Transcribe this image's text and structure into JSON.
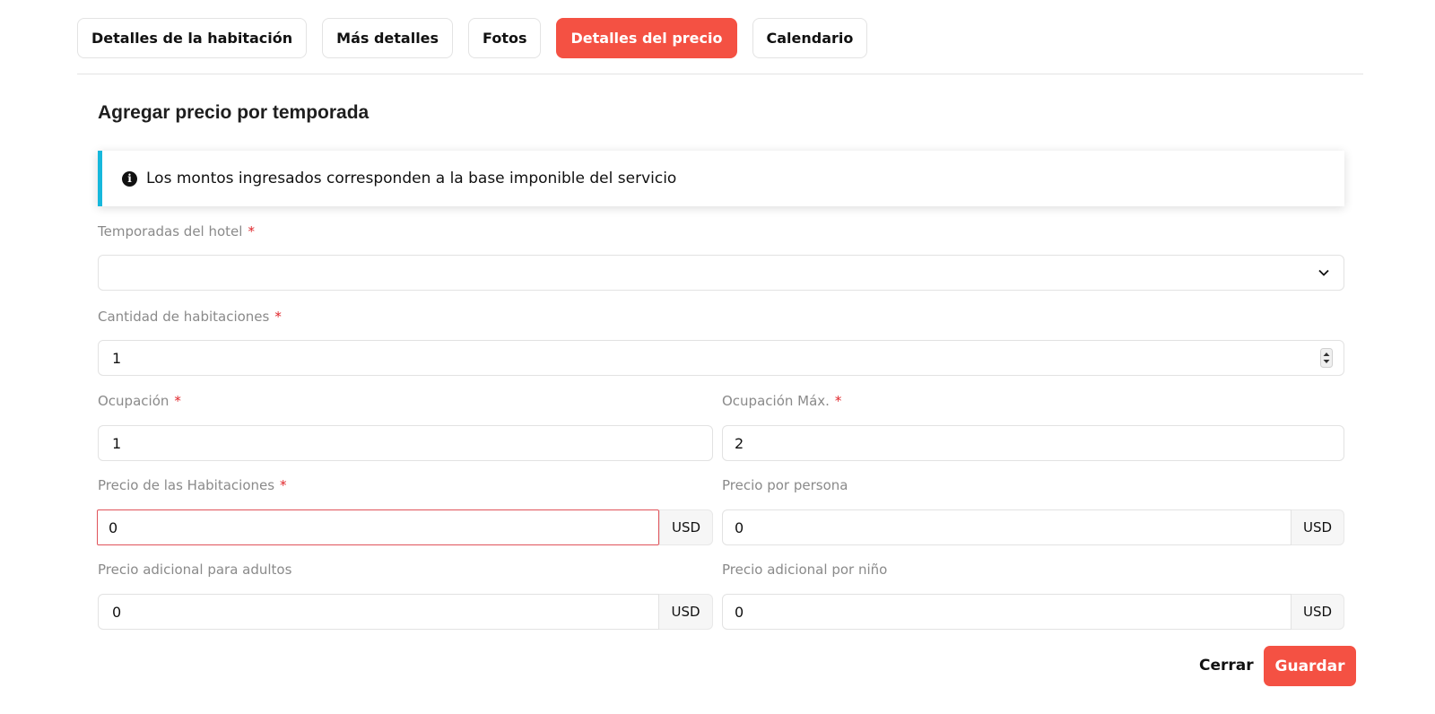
{
  "tabs": [
    {
      "label": "Detalles de la habitación",
      "active": false
    },
    {
      "label": "Más detalles",
      "active": false
    },
    {
      "label": "Fotos",
      "active": false
    },
    {
      "label": "Detalles del precio",
      "active": true
    },
    {
      "label": "Calendario",
      "active": false
    }
  ],
  "section_title": "Agregar precio por temporada",
  "alert": {
    "icon": "info-circle-icon",
    "text": "Los montos ingresados corresponden a la base imponible del servicio"
  },
  "form": {
    "seasons": {
      "label": "Temporadas del hotel",
      "required_mark": "*",
      "value": ""
    },
    "room_count": {
      "label": "Cantidad de habitaciones",
      "required_mark": "*",
      "value": "1"
    },
    "occupancy": {
      "label": "Ocupación",
      "required_mark": "*",
      "value": "1"
    },
    "max_occupancy": {
      "label": "Ocupación Máx.",
      "required_mark": "*",
      "value": "2"
    },
    "room_price": {
      "label": "Precio de las Habitaciones",
      "required_mark": "*",
      "value": "0",
      "currency": "USD"
    },
    "price_per_person": {
      "label": "Precio por persona",
      "value": "0",
      "currency": "USD"
    },
    "extra_adult_price": {
      "label": "Precio adicional para adultos",
      "value": "0",
      "currency": "USD"
    },
    "extra_child_price": {
      "label": "Precio adicional por niño",
      "value": "0",
      "currency": "USD"
    }
  },
  "actions": {
    "close_label": "Cerrar",
    "save_label": "Guardar"
  },
  "colors": {
    "accent": "#f45143",
    "info": "#17b8dc",
    "error": "#e0535a"
  }
}
